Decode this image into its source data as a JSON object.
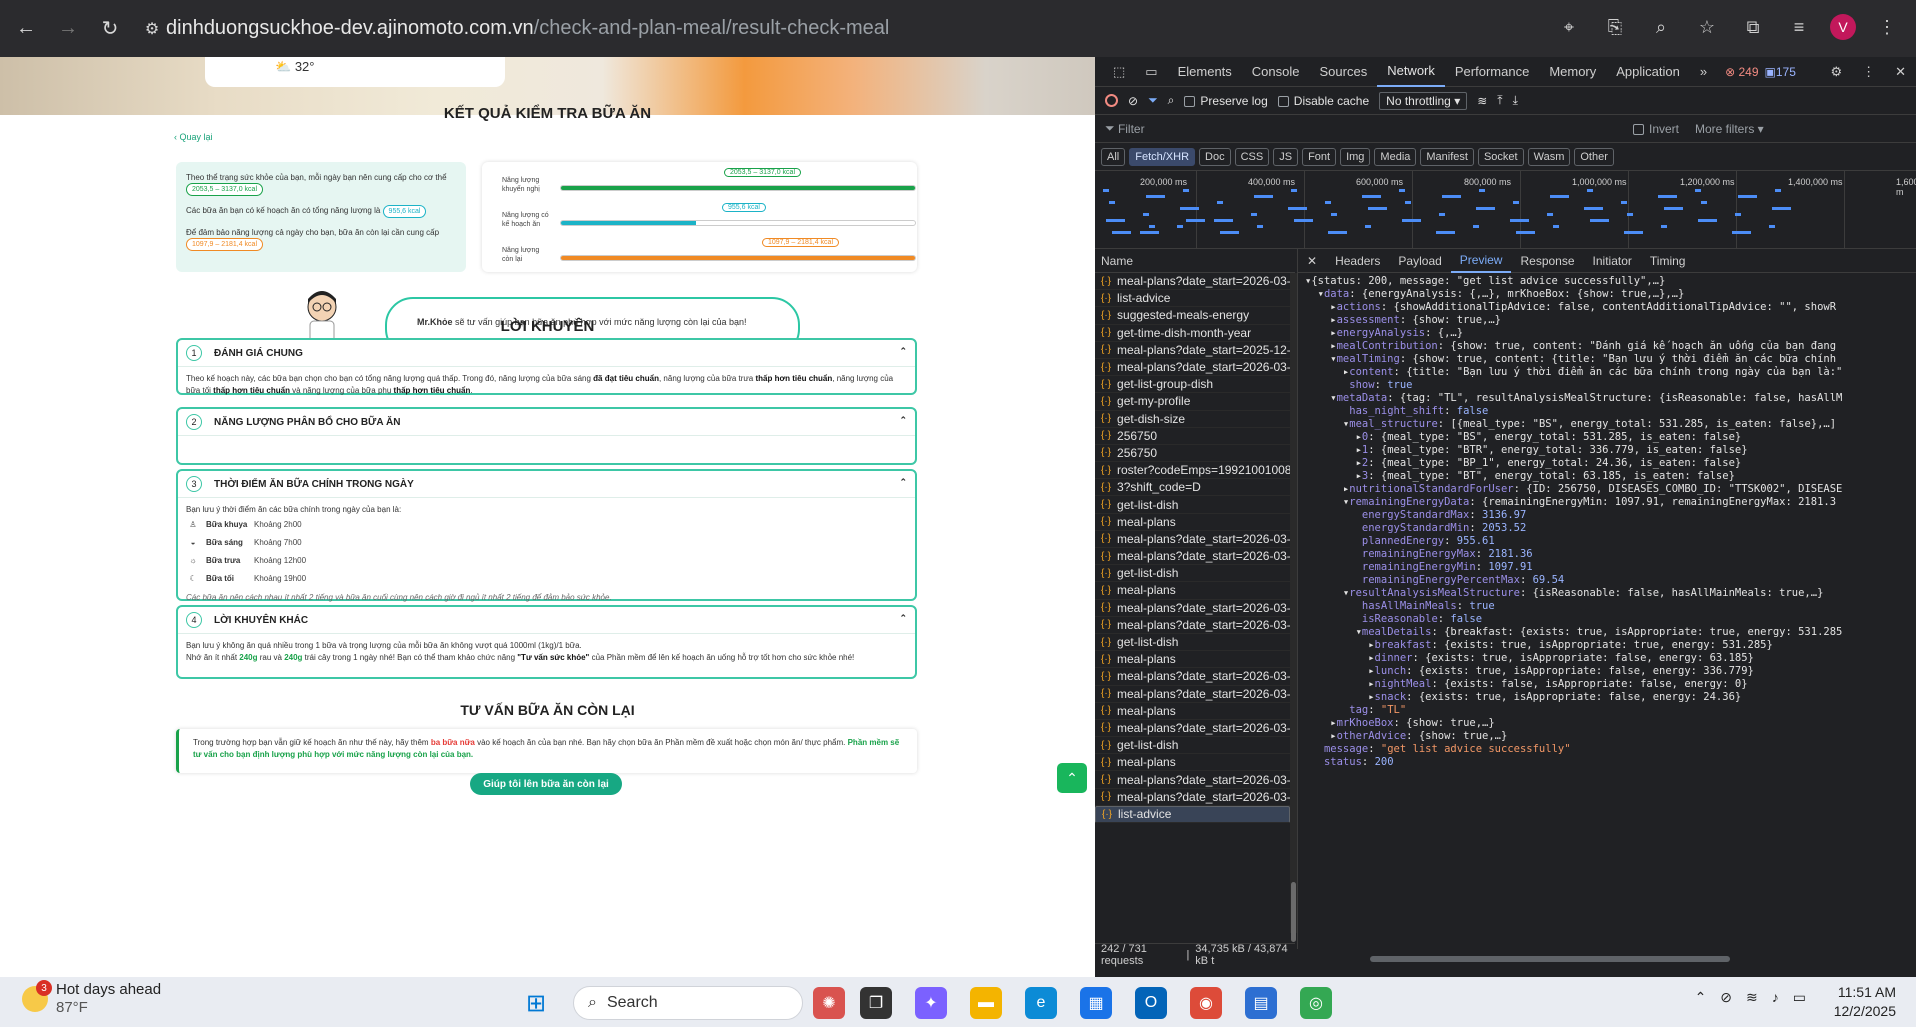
{
  "browser": {
    "url_host": "dinhduongsuckhoe-dev.ajinomoto.com.vn",
    "url_path": "/check-and-plan-meal/result-check-meal",
    "profile_initial": "V"
  },
  "page": {
    "weather_temp": "32°",
    "back_label": "Quay lại",
    "title": "KẾT QUẢ KIỂM TRA BỮA ĂN",
    "energy_summary": {
      "line1": "Theo thể trạng sức khỏe của bạn, mỗi ngày bạn nên cung cấp cho cơ thể",
      "line1_value": "2053,5 – 3137,0 kcal",
      "line2": "Các bữa ăn bạn có kế hoạch ăn có tổng năng lượng là",
      "line2_value": "955,6 kcal",
      "line3": "Để đảm bảo năng lượng cả ngày cho bạn, bữa ăn còn lại cần cung cấp",
      "line3_value": "1097,9 – 2181,4 kcal"
    },
    "energy_bars": [
      {
        "label": "Năng lượng khuyến nghị",
        "tag": "2053,5 – 3137,0 kcal",
        "fill": 1.0,
        "color": "#19a24a"
      },
      {
        "label": "Năng lượng có kế hoạch ăn",
        "tag": "955,6 kcal",
        "fill": 0.38,
        "color": "#1bb3c7"
      },
      {
        "label": "Năng lượng còn lại",
        "tag": "1097,9 – 2181,4 kcal",
        "fill": 1.0,
        "color": "#f08a24"
      }
    ],
    "mrkhoe_name": "Mr.Khỏe",
    "mrkhoe_text": "sẽ tư vấn giúp bạn bữa ăn phù hợp với mức năng lượng còn lại của bạn!",
    "advice_title": "LỜI KHUYÊN",
    "sections": [
      {
        "num": "1",
        "title": "ĐÁNH GIÁ CHUNG"
      },
      {
        "num": "2",
        "title": "NĂNG LƯỢNG PHÂN BỔ CHO BỮA ĂN"
      },
      {
        "num": "3",
        "title": "THỜI ĐIỂM ĂN BỮA CHÍNH TRONG NGÀY"
      },
      {
        "num": "4",
        "title": "LỜI KHUYÊN KHÁC"
      }
    ],
    "assessment": {
      "t1": "Theo kế hoạch này, các bữa bạn chọn cho bạn có tổng năng lượng quá thấp. Trong đó, năng lượng của bữa sáng ",
      "b1": "đã đạt tiêu chuẩn",
      "t2": ", năng lượng của bữa trưa ",
      "b2": "thấp hơn tiêu chuẩn",
      "t3": ", năng lượng của bữa tối ",
      "b3": "thấp hơn tiêu chuẩn",
      "t4": " và năng lượng của bữa phụ ",
      "b4": "thấp hơn tiêu chuẩn",
      "t5": "."
    },
    "timing": {
      "intro": "Bạn lưu ý thời điểm ăn các bữa chính trong ngày của bạn là:",
      "meals": [
        {
          "icon": "person-icon",
          "name": "Bữa khuya",
          "time": "Khoảng 2h00"
        },
        {
          "icon": "sunrise-icon",
          "name": "Bữa sáng",
          "time": "Khoảng 7h00"
        },
        {
          "icon": "sun-icon",
          "name": "Bữa trưa",
          "time": "Khoảng 12h00"
        },
        {
          "icon": "moon-icon",
          "name": "Bữa tối",
          "time": "Khoảng 19h00"
        }
      ],
      "note": "Các bữa ăn nên cách nhau ít nhất 2 tiếng và bữa ăn cuối cùng nên cách giờ đi ngủ ít nhất 2 tiếng để đảm bảo sức khỏe."
    },
    "other_advice": {
      "l1": "Bạn lưu ý không ăn quá nhiều trong 1 bữa và trọng lượng của mỗi bữa ăn không vượt quá 1000ml (1kg)/1 bữa.",
      "l2a": "Nhớ ăn ít nhất ",
      "l2b": "240g",
      "l2c": " rau và ",
      "l2d": "240g",
      "l2e": " trái cây trong 1 ngày nhé! Bạn có thể tham khảo chức năng ",
      "l2f": "\"Tư vấn sức khỏe\"",
      "l2g": " của Phần mềm để lên kế hoạch ăn uống hỗ trợ tốt hơn cho sức khỏe nhé!"
    },
    "remain_title": "TƯ VẤN BỮA ĂN CÒN LẠI",
    "remain": {
      "a": "Trong trường hợp bạn vẫn giữ kế hoạch ăn như thế này, hãy thêm ",
      "b": "ba bữa nữa",
      "c": " vào kế hoạch ăn của bạn nhé. Bạn hãy chọn bữa ăn Phần mềm đề xuất hoặc chọn món ăn/ thực phẩm. ",
      "d": "Phần mềm sẽ tư vấn cho bạn định lượng phù hợp với mức năng lượng còn lại của bạn."
    },
    "help_button": "Giúp tôi lên bữa ăn còn lại"
  },
  "devtools": {
    "tabs": [
      "Elements",
      "Console",
      "Sources",
      "Network",
      "Performance",
      "Memory",
      "Application"
    ],
    "active_tab": "Network",
    "errors": "249",
    "warnings": "175",
    "preserve_log": "Preserve log",
    "disable_cache": "Disable cache",
    "throttling": "No throttling",
    "filter_placeholder": "Filter",
    "invert": "Invert",
    "more_filters": "More filters",
    "types": [
      "All",
      "Fetch/XHR",
      "Doc",
      "CSS",
      "JS",
      "Font",
      "Img",
      "Media",
      "Manifest",
      "Socket",
      "Wasm",
      "Other"
    ],
    "active_type": "Fetch/XHR",
    "timeline_ticks": [
      "200,000 ms",
      "400,000 ms",
      "600,000 ms",
      "800,000 ms",
      "1,000,000 ms",
      "1,200,000 ms",
      "1,400,000 ms",
      "1,600,000 m"
    ],
    "name_header": "Name",
    "requests": [
      "meal-plans?date_start=2026-03-01&...",
      "list-advice",
      "suggested-meals-energy",
      "get-time-dish-month-year",
      "meal-plans?date_start=2025-12-01&...",
      "meal-plans?date_start=2026-03-01&...",
      "get-list-group-dish",
      "get-my-profile",
      "get-dish-size",
      "256750",
      "256750",
      "roster?codeEmps=19921001008&dat...",
      "3?shift_code=D",
      "get-list-dish",
      "meal-plans",
      "meal-plans?date_start=2026-03-01&...",
      "meal-plans?date_start=2026-03-01&...",
      "get-list-dish",
      "meal-plans",
      "meal-plans?date_start=2026-03-01&...",
      "meal-plans?date_start=2026-03-01&...",
      "get-list-dish",
      "meal-plans",
      "meal-plans?date_start=2026-03-01&...",
      "meal-plans?date_start=2026-03-01&...",
      "meal-plans",
      "meal-plans?date_start=2026-03-01&...",
      "get-list-dish",
      "meal-plans",
      "meal-plans?date_start=2026-03-01&...",
      "meal-plans?date_start=2026-03-01&...",
      "list-advice"
    ],
    "panel_tabs": [
      "Headers",
      "Payload",
      "Preview",
      "Response",
      "Initiator",
      "Timing"
    ],
    "active_panel_tab": "Preview",
    "status_requests": "242 / 731 requests",
    "status_size": "34,735 kB / 43,874 kB t",
    "preview_lines": [
      "▾{status: 200, message: \"get list advice successfully\",…}",
      "  ▾data: {energyAnalysis: {,…}, mrKhoeBox: {show: true,…},…}",
      "    ▸actions: {showAdditionalTipAdvice: false, contentAdditionalTipAdvice: \"\", showR",
      "    ▸assessment: {show: true,…}",
      "    ▸energyAnalysis: {,…}",
      "    ▸mealContribution: {show: true, content: \"Đánh giá kế hoạch ăn uống của bạn đang",
      "    ▾mealTiming: {show: true, content: {title: \"Bạn lưu ý thời điểm ăn các bữa chính",
      "      ▸content: {title: \"Bạn lưu ý thời điểm ăn các bữa chính trong ngày của bạn là:\"",
      "       show: true",
      "    ▾metaData: {tag: \"TL\", resultAnalysisMealStructure: {isReasonable: false, hasAllM",
      "       has_night_shift: false",
      "      ▾meal_structure: [{meal_type: \"BS\", energy_total: 531.285, is_eaten: false},…]",
      "        ▸0: {meal_type: \"BS\", energy_total: 531.285, is_eaten: false}",
      "        ▸1: {meal_type: \"BTR\", energy_total: 336.779, is_eaten: false}",
      "        ▸2: {meal_type: \"BP_1\", energy_total: 24.36, is_eaten: false}",
      "        ▸3: {meal_type: \"BT\", energy_total: 63.185, is_eaten: false}",
      "      ▸nutritionalStandardForUser: {ID: 256750, DISEASES_COMBO_ID: \"TTSK002\", DISEASE",
      "      ▾remainingEnergyData: {remainingEnergyMin: 1097.91, remainingEnergyMax: 2181.3",
      "         energyStandardMax: 3136.97",
      "         energyStandardMin: 2053.52",
      "         plannedEnergy: 955.61",
      "         remainingEnergyMax: 2181.36",
      "         remainingEnergyMin: 1097.91",
      "         remainingEnergyPercentMax: 69.54",
      "      ▾resultAnalysisMealStructure: {isReasonable: false, hasAllMainMeals: true,…}",
      "         hasAllMainMeals: true",
      "         isReasonable: false",
      "        ▾mealDetails: {breakfast: {exists: true, isAppropriate: true, energy: 531.285",
      "          ▸breakfast: {exists: true, isAppropriate: true, energy: 531.285}",
      "          ▸dinner: {exists: true, isAppropriate: false, energy: 63.185}",
      "          ▸lunch: {exists: true, isAppropriate: false, energy: 336.779}",
      "          ▸nightMeal: {exists: false, isAppropriate: false, energy: 0}",
      "          ▸snack: {exists: true, isAppropriate: false, energy: 24.36}",
      "       tag: \"TL\"",
      "    ▸mrKhoeBox: {show: true,…}",
      "    ▸otherAdvice: {show: true,…}",
      "   message: \"get list advice successfully\"",
      "   status: 200"
    ]
  },
  "taskbar": {
    "weather_badge": "3",
    "weather_title": "Hot days ahead",
    "weather_temp": "87°F",
    "search_label": "Search",
    "time": "11:51 AM",
    "date": "12/2/2025"
  }
}
